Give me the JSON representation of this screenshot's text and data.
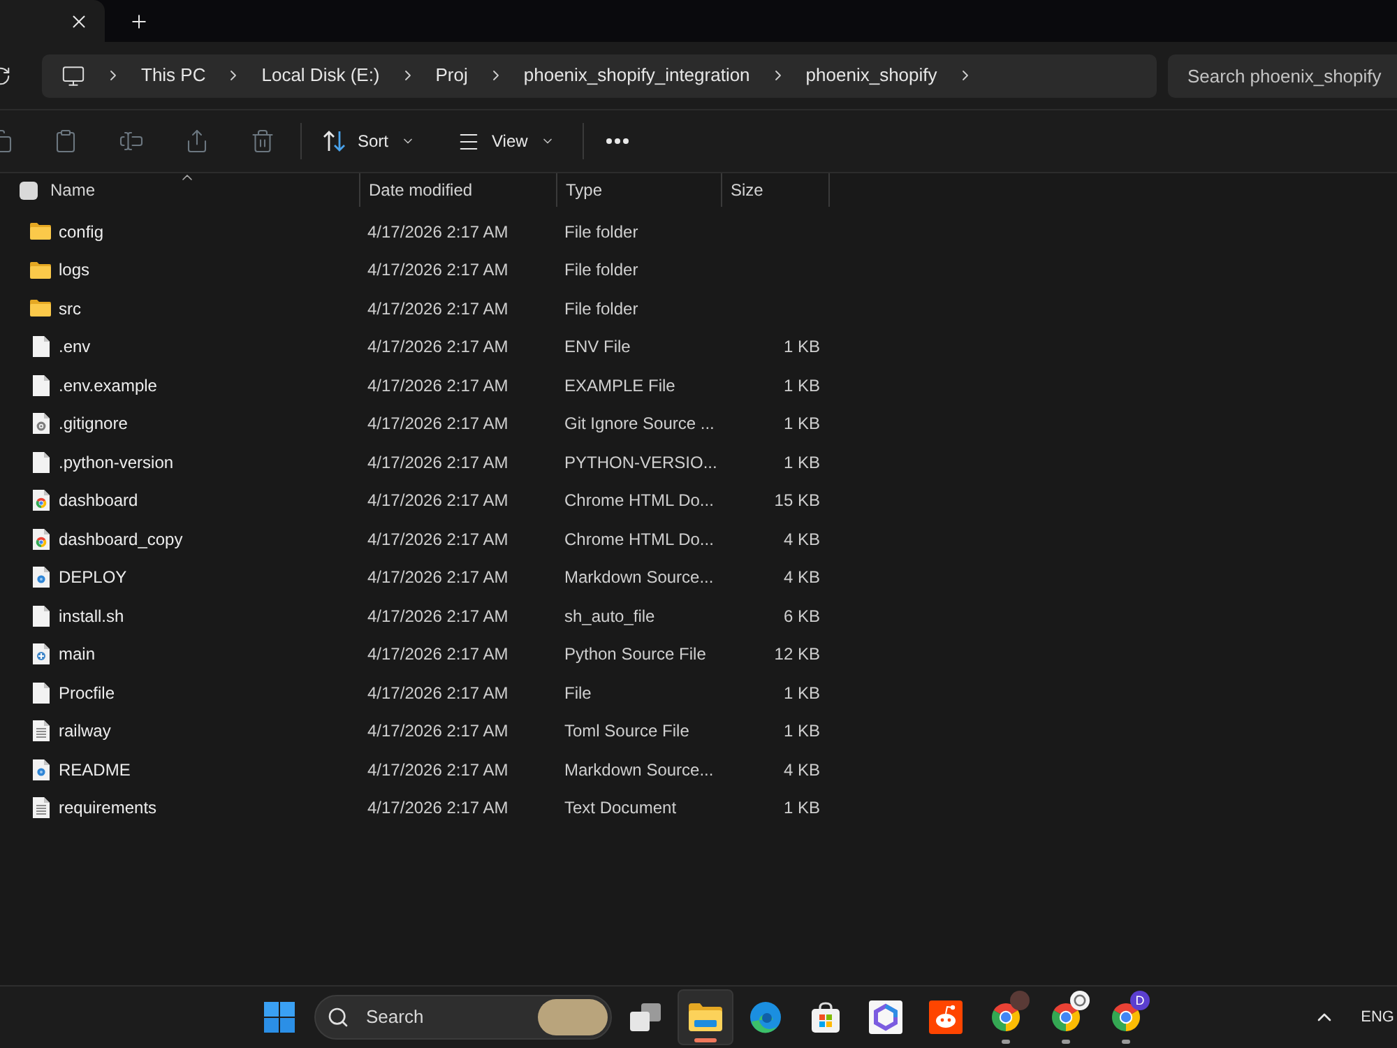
{
  "breadcrumbs": [
    "This PC",
    "Local Disk (E:)",
    "Proj",
    "phoenix_shopify_integration",
    "phoenix_shopify"
  ],
  "search": {
    "placeholder": "Search phoenix_shopify"
  },
  "toolbar": {
    "actions": [
      {
        "kind": "copy",
        "disabled": true
      },
      {
        "kind": "paste",
        "disabled": true
      },
      {
        "kind": "rename",
        "disabled": true
      },
      {
        "kind": "share",
        "disabled": true
      },
      {
        "kind": "delete",
        "disabled": true
      }
    ],
    "sort": "Sort",
    "view": "View"
  },
  "select_all": {
    "checked": false
  },
  "columns": [
    {
      "label": "Name",
      "sorted": true
    },
    {
      "label": "Date modified",
      "sorted": false
    },
    {
      "label": "Type",
      "sorted": false
    },
    {
      "label": "Size",
      "sorted": false
    }
  ],
  "rows": [
    {
      "kind": "folder",
      "name": "config",
      "modified": "4/17/2026 2:17 AM",
      "type": "File folder"
    },
    {
      "kind": "folder",
      "name": "logs",
      "modified": "4/17/2026 2:17 AM",
      "type": "File folder"
    },
    {
      "kind": "folder",
      "name": "src",
      "modified": "4/17/2026 2:17 AM",
      "type": "File folder"
    },
    {
      "kind": "file",
      "name": ".env",
      "modified": "4/17/2026 2:17 AM",
      "type": "ENV File",
      "size": "1 KB"
    },
    {
      "kind": "file",
      "name": ".env.example",
      "modified": "4/17/2026 2:17 AM",
      "type": "EXAMPLE File",
      "size": "1 KB"
    },
    {
      "kind": "gear",
      "name": ".gitignore",
      "modified": "4/17/2026 2:17 AM",
      "type": "Git Ignore Source ...",
      "size": "1 KB"
    },
    {
      "kind": "file",
      "name": ".python-version",
      "modified": "4/17/2026 2:17 AM",
      "type": "PYTHON-VERSIO...",
      "size": "1 KB"
    },
    {
      "kind": "chrome",
      "name": "dashboard",
      "modified": "4/17/2026 2:17 AM",
      "type": "Chrome HTML Do...",
      "size": "15 KB"
    },
    {
      "kind": "chrome",
      "name": "dashboard_copy",
      "modified": "4/17/2026 2:17 AM",
      "type": "Chrome HTML Do...",
      "size": "4 KB"
    },
    {
      "kind": "markdown",
      "name": "DEPLOY",
      "modified": "4/17/2026 2:17 AM",
      "type": "Markdown Source...",
      "size": "4 KB"
    },
    {
      "kind": "file",
      "name": "install.sh",
      "modified": "4/17/2026 2:17 AM",
      "type": "sh_auto_file",
      "size": "6 KB"
    },
    {
      "kind": "python",
      "name": "main",
      "modified": "4/17/2026 2:17 AM",
      "type": "Python Source File",
      "size": "12 KB"
    },
    {
      "kind": "file",
      "name": "Procfile",
      "modified": "4/17/2026 2:17 AM",
      "type": "File",
      "size": "1 KB"
    },
    {
      "kind": "text",
      "name": "railway",
      "modified": "4/17/2026 2:17 AM",
      "type": "Toml Source File",
      "size": "1 KB"
    },
    {
      "kind": "markdown",
      "name": "README",
      "modified": "4/17/2026 2:17 AM",
      "type": "Markdown Source...",
      "size": "4 KB"
    },
    {
      "kind": "text",
      "name": "requirements",
      "modified": "4/17/2026 2:17 AM",
      "type": "Text Document",
      "size": "1 KB"
    }
  ],
  "taskbar": {
    "search_label": "Search",
    "apps": [
      {
        "kind": "task_view",
        "running": false,
        "selected": false
      },
      {
        "kind": "explorer",
        "running": true,
        "selected": true
      },
      {
        "kind": "edge",
        "running": false,
        "selected": false
      },
      {
        "kind": "store",
        "running": false,
        "selected": false
      },
      {
        "kind": "tile_app",
        "running": false,
        "selected": false
      },
      {
        "kind": "reddit",
        "running": false,
        "selected": false
      },
      {
        "kind": "chrome",
        "running": true,
        "selected": false,
        "badge": {
          "kind": "photo"
        }
      },
      {
        "kind": "chrome",
        "running": true,
        "selected": false,
        "badge": {
          "kind": "glyph"
        }
      },
      {
        "kind": "chrome",
        "running": true,
        "selected": false,
        "badge": {
          "kind": "letter",
          "text": "D"
        }
      }
    ],
    "language": "ENG"
  }
}
